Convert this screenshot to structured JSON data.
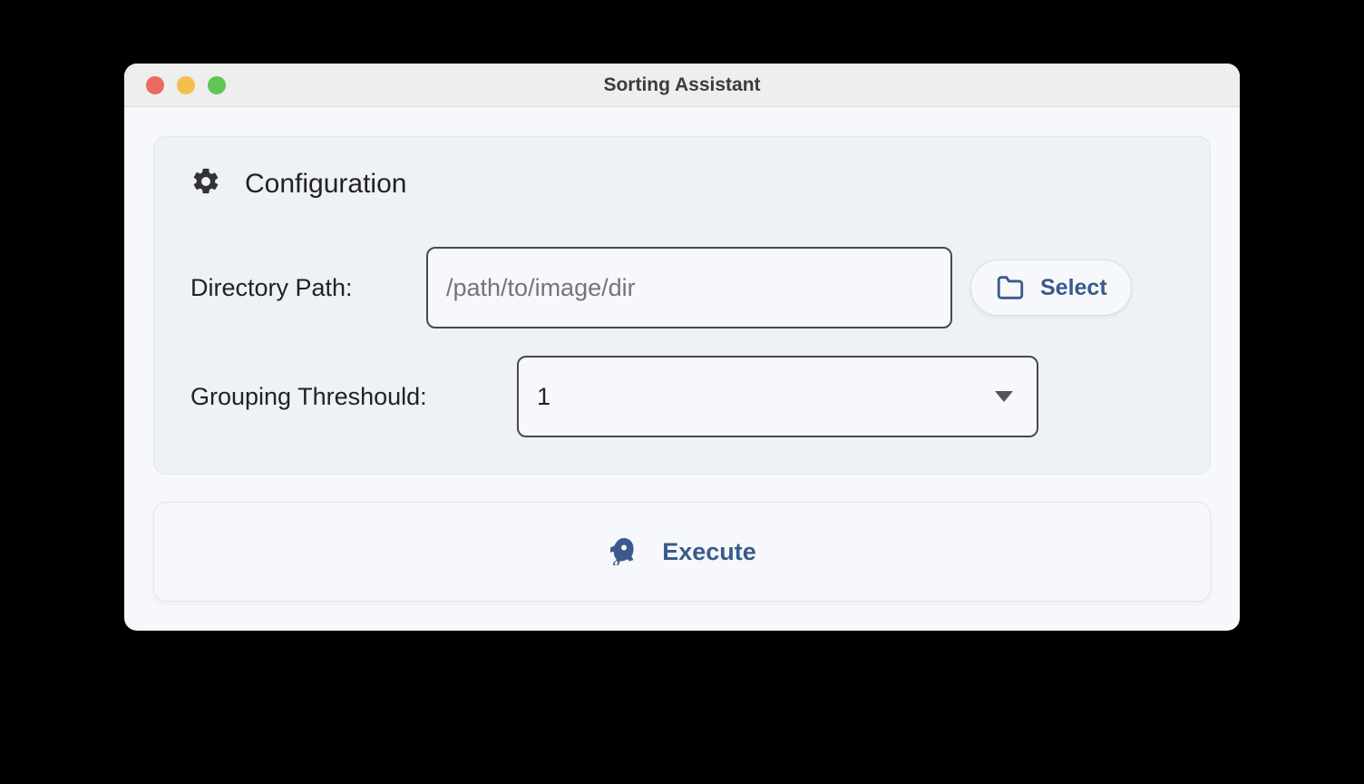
{
  "window": {
    "title": "Sorting Assistant"
  },
  "config": {
    "heading": "Configuration",
    "directory": {
      "label": "Directory Path:",
      "placeholder": "/path/to/image/dir",
      "select_button": "Select"
    },
    "threshold": {
      "label": "Grouping Threshould:",
      "value": "1"
    }
  },
  "actions": {
    "execute_label": "Execute"
  }
}
